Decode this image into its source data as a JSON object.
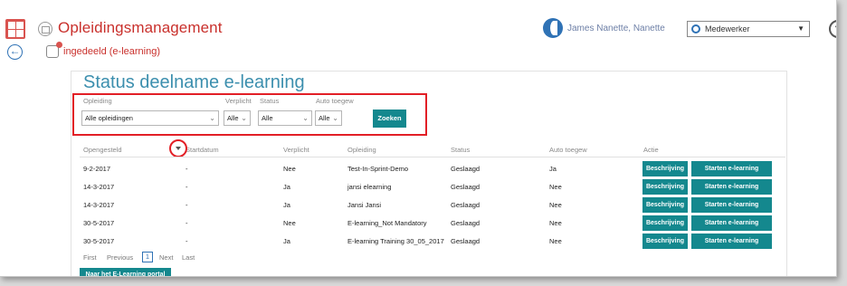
{
  "header": {
    "app_title": "Opleidingsmanagement",
    "user_name": "James Nanette, Nanette",
    "role_value": "Medewerker"
  },
  "breadcrumb": {
    "label": "ingedeeld (e-learning)"
  },
  "page": {
    "title": "Status deelname e-learning"
  },
  "filters": {
    "opleiding": {
      "label": "Opleiding",
      "value": "Alle opleidingen"
    },
    "verplicht": {
      "label": "Verplicht",
      "value": "Alle"
    },
    "status": {
      "label": "Status",
      "value": "Alle"
    },
    "auto_toegew": {
      "label": "Auto toegew",
      "value": "Alle"
    },
    "search_button": "Zoeken"
  },
  "table": {
    "headers": [
      "Opengesteld",
      "Startdatum",
      "Verplicht",
      "Opleiding",
      "Status",
      "Auto toegew",
      "Actie"
    ],
    "rows": [
      {
        "opengesteld": "9-2-2017",
        "startdatum": "-",
        "verplicht": "Nee",
        "opleiding": "Test-In-Sprint-Demo",
        "status": "Geslaagd",
        "auto": "Ja"
      },
      {
        "opengesteld": "14-3-2017",
        "startdatum": "-",
        "verplicht": "Ja",
        "opleiding": "jansi elearning",
        "status": "Geslaagd",
        "auto": "Nee"
      },
      {
        "opengesteld": "14-3-2017",
        "startdatum": "-",
        "verplicht": "Ja",
        "opleiding": "Jansi Jansi",
        "status": "Geslaagd",
        "auto": "Nee"
      },
      {
        "opengesteld": "30-5-2017",
        "startdatum": "-",
        "verplicht": "Nee",
        "opleiding": "E-learning_Not Mandatory",
        "status": "Geslaagd",
        "auto": "Nee"
      },
      {
        "opengesteld": "30-5-2017",
        "startdatum": "-",
        "verplicht": "Ja",
        "opleiding": "E-learning Training 30_05_2017",
        "status": "Geslaagd",
        "auto": "Nee"
      }
    ],
    "action_describe": "Beschrijving",
    "action_start": "Starten e-learning"
  },
  "pager": {
    "first": "First",
    "previous": "Previous",
    "current": "1",
    "next": "Next",
    "last": "Last"
  },
  "portal_button": "Naar het E-Learning portal",
  "colors": {
    "accent": "#14888e",
    "brand_red": "#c9302c",
    "highlight": "#e21f26",
    "title_blue": "#3c8fae"
  }
}
